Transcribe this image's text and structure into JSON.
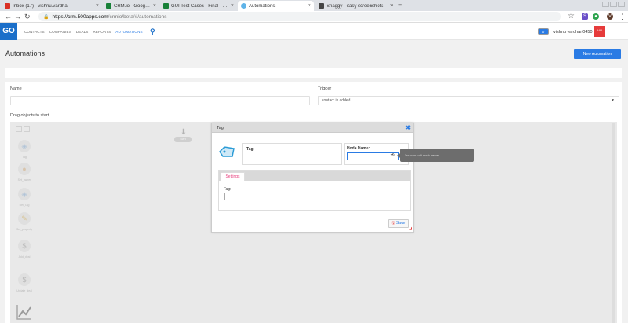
{
  "browser": {
    "tabs": [
      {
        "label": "Inbox (17) - vishnu.vardha",
        "fav": "#d93025"
      },
      {
        "label": "CRM.io - Google Sheets",
        "fav": "#188038"
      },
      {
        "label": "GUI Test Cases - Final - Go",
        "fav": "#188038"
      },
      {
        "label": "Automations",
        "fav": "#5fb3e8"
      },
      {
        "label": "Snaggy - easy screenshots",
        "fav": "#444444"
      }
    ],
    "new_tab": "+",
    "url_domain": "https://crm.500apps.com",
    "url_path": "/crmio/beta/#/automations"
  },
  "app": {
    "logo": "GO",
    "menu": [
      "CONTACTS",
      "COMPANIES",
      "DEALS",
      "REPORTS",
      "AUTOMATIONS"
    ],
    "notification_count": "0",
    "user_name": "vishnu vardhan0450"
  },
  "page": {
    "title": "Automations",
    "new_button": "New Automation"
  },
  "form": {
    "name_label": "Name",
    "trigger_label": "Trigger",
    "trigger_value": "contact is added",
    "drag_label": "Drag objects to start"
  },
  "tools": [
    {
      "icon": "tag-icon",
      "glyph": "◈",
      "label": "Tag"
    },
    {
      "icon": "user-icon",
      "glyph": "●",
      "label": "Set_owner"
    },
    {
      "icon": "tag-icon",
      "glyph": "◈",
      "label": "Del_Tag"
    },
    {
      "icon": "pencil-icon",
      "glyph": "✎",
      "label": "Set_property"
    },
    {
      "icon": "dollar-icon",
      "glyph": "$",
      "label": "Add_deal"
    },
    {
      "icon": "dollar-icon",
      "glyph": "$",
      "label": "Update_deal"
    },
    {
      "icon": "chart-icon",
      "glyph": "📈",
      "label": ""
    }
  ],
  "start_node": {
    "label": "Start"
  },
  "modal": {
    "title": "Tag",
    "tag_name": "Tag",
    "node_name_label": "Node Name:",
    "settings_tab": "Settings",
    "tag_field_label": "Tag:",
    "save_label": "Save",
    "tooltip": "You can edit node name."
  },
  "colors": {
    "accent": "#2a7be4",
    "avatar": "#e63b3b",
    "settings_tab": "#e63b7a"
  }
}
